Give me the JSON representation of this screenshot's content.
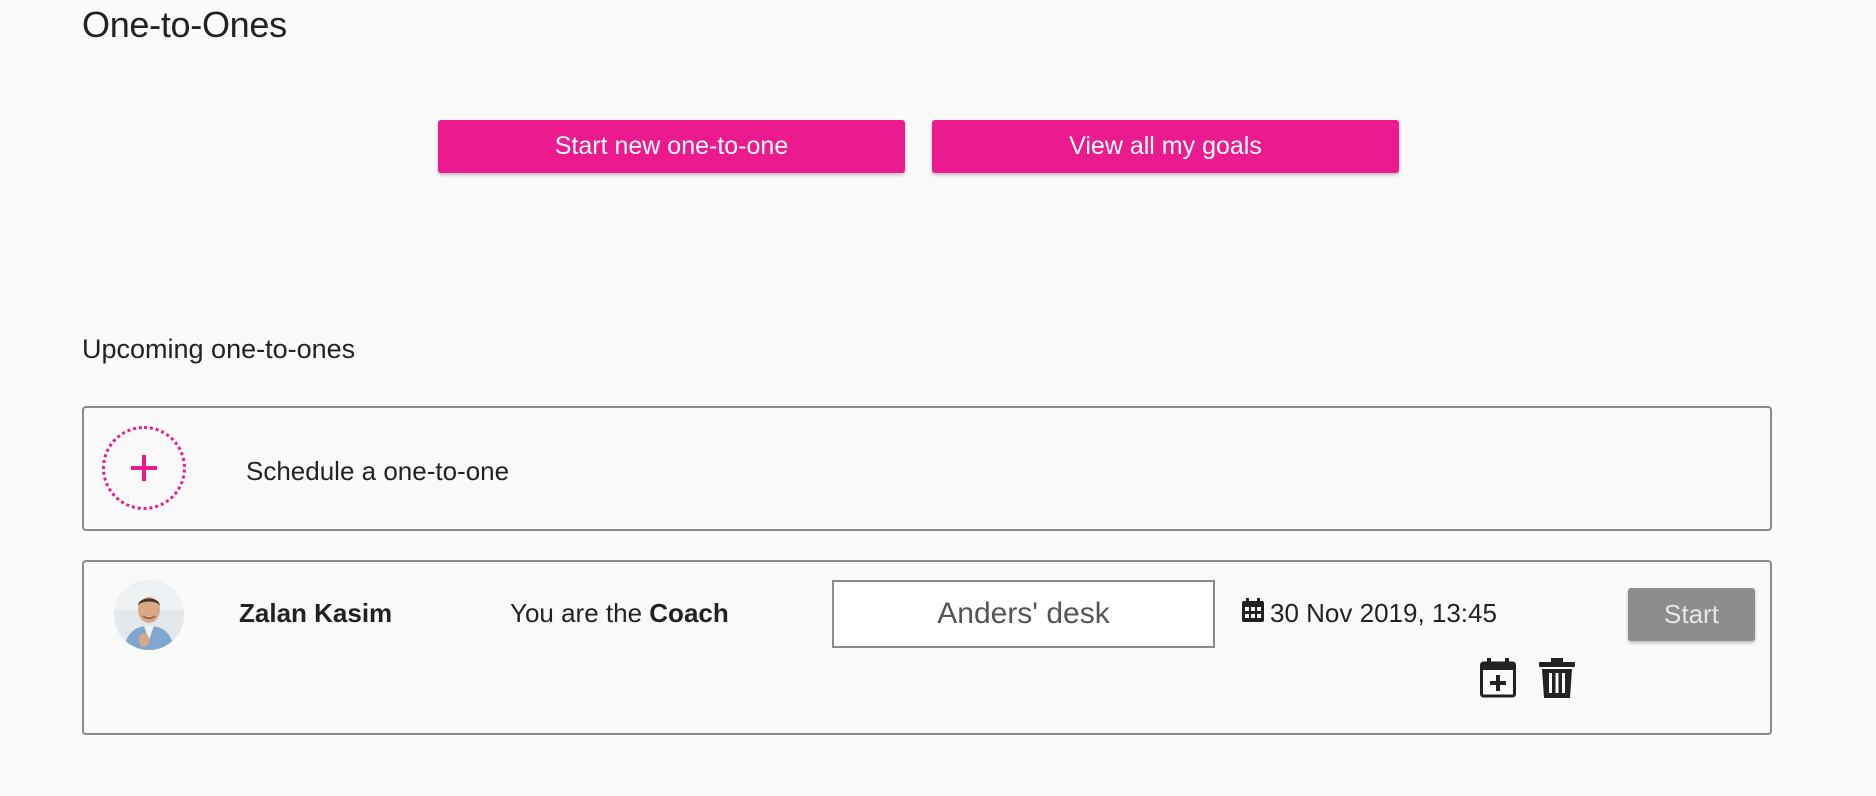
{
  "page": {
    "title": "One-to-Ones"
  },
  "actions": {
    "start_new_label": "Start new one-to-one",
    "view_goals_label": "View all my goals"
  },
  "upcoming": {
    "section_title": "Upcoming one-to-ones",
    "schedule_label": "Schedule a one-to-one",
    "schedule_icon": "plus-icon",
    "meetings": [
      {
        "person_name": "Zalan Kasim",
        "role_prefix": "You are the",
        "role": "Coach",
        "location": "Anders' desk",
        "datetime": "30 Nov 2019, 13:45",
        "start_label": "Start",
        "icons": [
          "calendar-icon",
          "calendar-add-icon",
          "trash-icon"
        ]
      }
    ]
  },
  "colors": {
    "accent": "#ec1a8f",
    "disabled_button": "#8d8d8d",
    "border": "#8a8a8a",
    "background": "#fafafa"
  }
}
